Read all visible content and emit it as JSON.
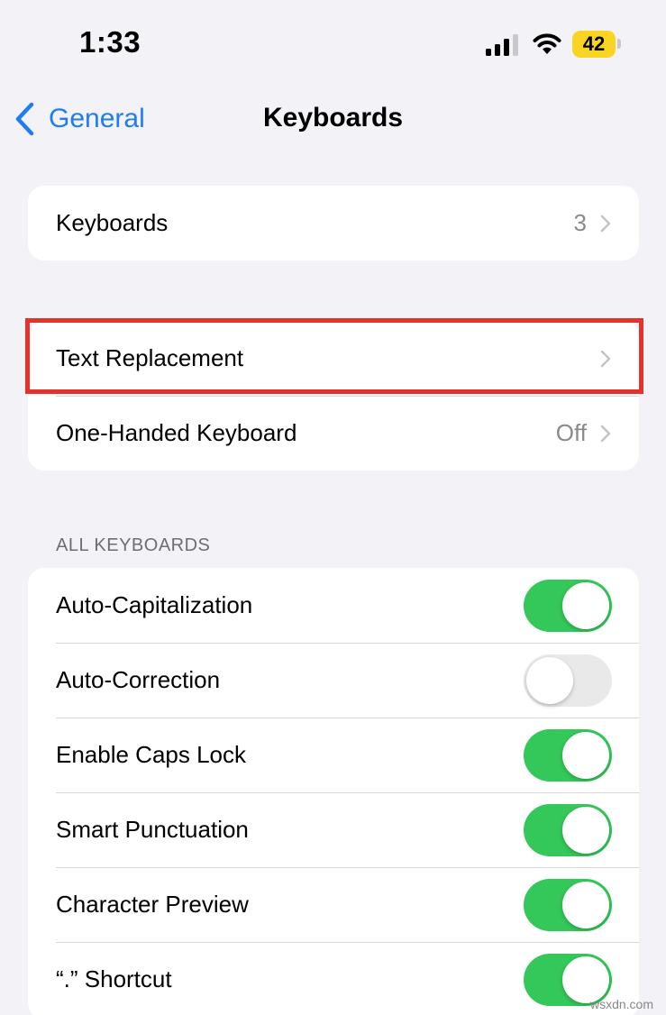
{
  "status_bar": {
    "time": "1:33",
    "battery": "42",
    "icons": [
      "cellular-signal-icon",
      "wifi-icon",
      "battery-icon"
    ]
  },
  "nav": {
    "back_label": "General",
    "title": "Keyboards",
    "accent_color": "#1e7cf5"
  },
  "group1": {
    "keyboards": {
      "label": "Keyboards",
      "value": "3"
    }
  },
  "group2": {
    "text_replacement": {
      "label": "Text Replacement"
    },
    "one_handed": {
      "label": "One-Handed Keyboard",
      "value": "Off"
    }
  },
  "all_keyboards": {
    "header": "ALL KEYBOARDS",
    "toggles": [
      {
        "label": "Auto-Capitalization",
        "on": true
      },
      {
        "label": "Auto-Correction",
        "on": false
      },
      {
        "label": "Enable Caps Lock",
        "on": true
      },
      {
        "label": "Smart Punctuation",
        "on": true
      },
      {
        "label": "Character Preview",
        "on": true
      },
      {
        "label": "“.” Shortcut",
        "on": true
      }
    ]
  },
  "highlight_color": "#e5322d",
  "toggle_on_color": "#34c759",
  "watermark": "wsxdn.com"
}
